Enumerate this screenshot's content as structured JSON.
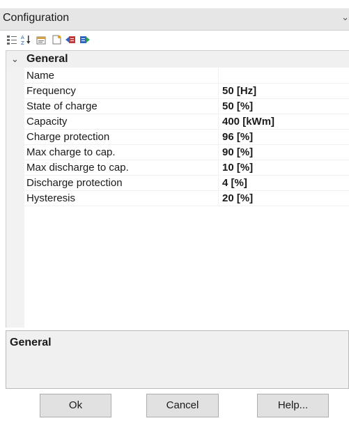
{
  "window": {
    "title": "Configuration"
  },
  "toolbar": {
    "icons": [
      "categorized-icon",
      "alphabetical-sort-icon",
      "property-pages-icon",
      "new-item-icon",
      "import-icon",
      "export-icon"
    ]
  },
  "grid": {
    "category": "General",
    "properties": [
      {
        "name": "Name",
        "value": ""
      },
      {
        "name": "Frequency",
        "value": "50 [Hz]"
      },
      {
        "name": "State of charge",
        "value": "50 [%]"
      },
      {
        "name": "Capacity",
        "value": "400 [kWm]"
      },
      {
        "name": "Charge protection",
        "value": "96 [%]"
      },
      {
        "name": "Max charge to cap.",
        "value": "90 [%]"
      },
      {
        "name": "Max discharge to cap.",
        "value": "10 [%]"
      },
      {
        "name": "Discharge protection",
        "value": "4 [%]"
      },
      {
        "name": "Hysteresis",
        "value": "20 [%]"
      }
    ]
  },
  "description": {
    "title": "General"
  },
  "buttons": {
    "ok": "Ok",
    "cancel": "Cancel",
    "help": "Help..."
  }
}
